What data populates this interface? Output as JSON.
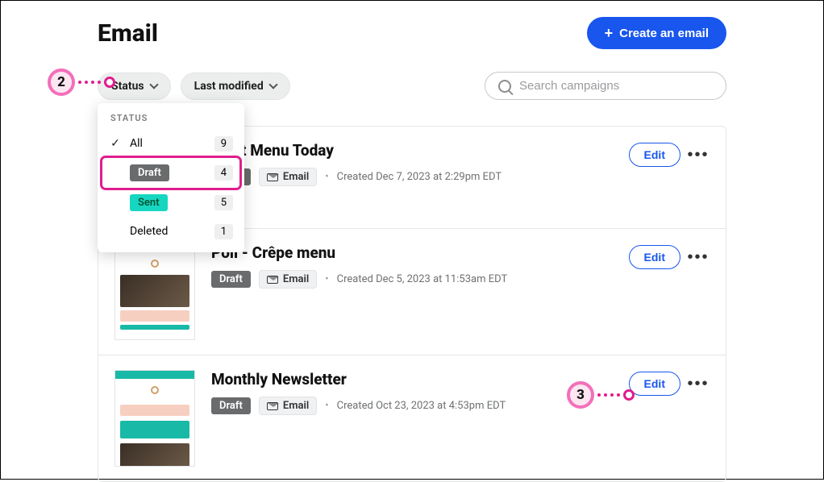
{
  "header": {
    "title": "Email",
    "create_label": "Create an email"
  },
  "filters": {
    "status_label": "Status",
    "lastmod_label": "Last modified"
  },
  "search": {
    "placeholder": "Search campaigns"
  },
  "status_dropdown": {
    "heading": "STATUS",
    "items": [
      {
        "label": "All",
        "count": "9",
        "selected": true,
        "style": "plain"
      },
      {
        "label": "Draft",
        "count": "4",
        "selected": false,
        "style": "draft",
        "highlighted": true
      },
      {
        "label": "Sent",
        "count": "5",
        "selected": false,
        "style": "sent"
      },
      {
        "label": "Deleted",
        "count": "1",
        "selected": false,
        "style": "plain"
      }
    ]
  },
  "campaigns": [
    {
      "title": "kfast Menu Today",
      "status": "Draft",
      "type": "Email",
      "created": "Created Dec 7, 2023 at 2:29pm EDT",
      "edit_label": "Edit"
    },
    {
      "title": "Poll - Crêpe menu",
      "status": "Draft",
      "type": "Email",
      "created": "Created Dec 5, 2023 at 11:53am EDT",
      "edit_label": "Edit"
    },
    {
      "title": "Monthly Newsletter",
      "status": "Draft",
      "type": "Email",
      "created": "Created Oct 23, 2023 at 4:53pm EDT",
      "edit_label": "Edit"
    }
  ],
  "callouts": {
    "step2": "2",
    "step3": "3"
  }
}
